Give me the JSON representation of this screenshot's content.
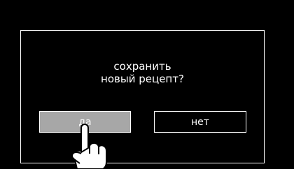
{
  "dialog": {
    "message_line1": "сохранить",
    "message_line2": "новый рецепт?",
    "yes_label": "да",
    "no_label": "нет"
  },
  "pointer": {
    "icon": "pointing-hand-icon"
  },
  "colors": {
    "background": "#000000",
    "border": "#ffffff",
    "selected_button": "#a7a7a7"
  }
}
